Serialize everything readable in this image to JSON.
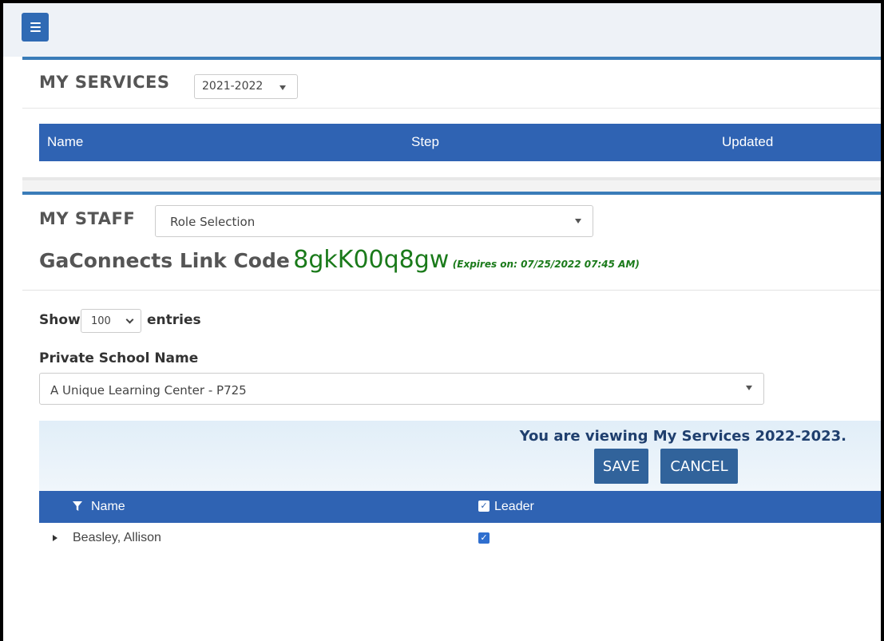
{
  "services": {
    "title": "MY SERVICES",
    "year_selected": "2021-2022",
    "columns": [
      "Name",
      "Step",
      "Updated"
    ]
  },
  "staff": {
    "title": "MY STAFF",
    "role_placeholder": "Role Selection",
    "link_code_label": "GaConnects Link Code",
    "link_code": "8gkK00q8gw",
    "link_expires": "(Expires on: 07/25/2022 07:45 AM)",
    "show_label": "Show",
    "entries_value": "100",
    "entries_label": "entries",
    "private_school_label": "Private School Name",
    "private_school_value": "A Unique Learning Center - P725",
    "viewing_notice": "You are viewing My Services 2022-2023.",
    "save_label": "SAVE",
    "cancel_label": "CANCEL",
    "columns": {
      "name": "Name",
      "leader": "Leader"
    },
    "rows": [
      {
        "name": "Beasley, Allison",
        "leader": true
      }
    ]
  },
  "colors": {
    "accent": "#2f63b3",
    "link_code": "#1a7a1a"
  },
  "icons": {
    "menu": "hamburger-icon",
    "filter": "filter-funnel-icon",
    "expand": "triangle-right-icon"
  }
}
